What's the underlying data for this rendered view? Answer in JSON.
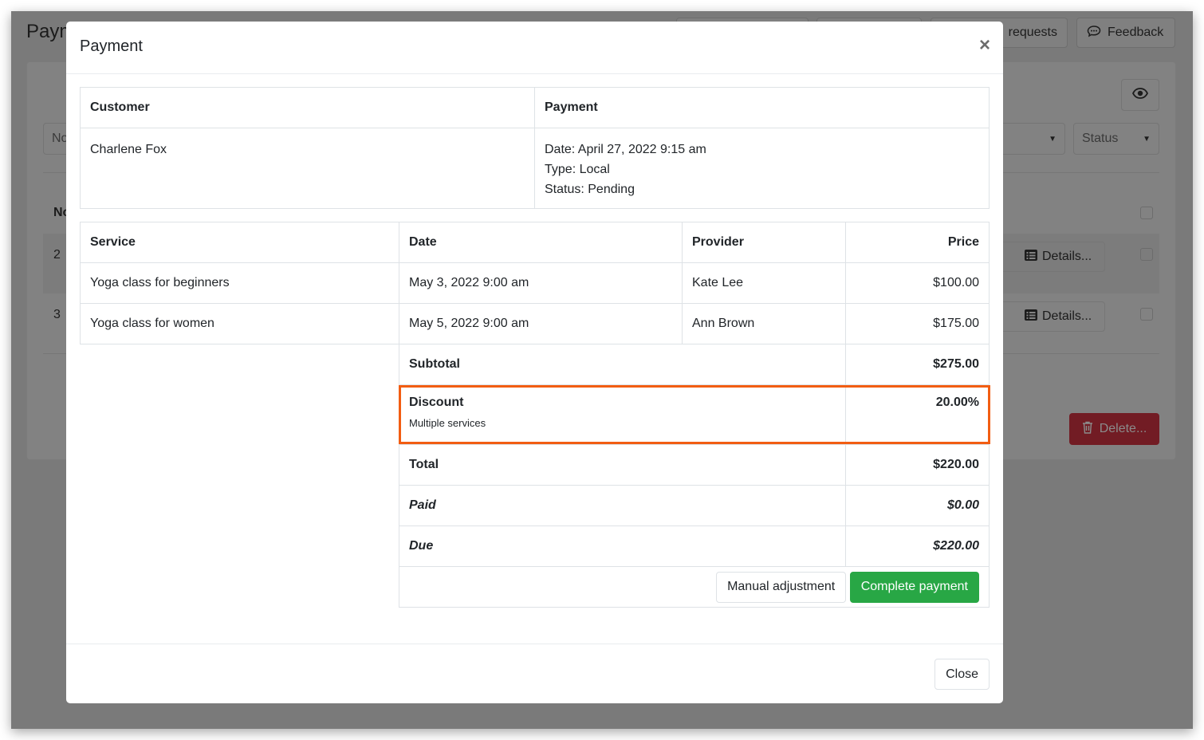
{
  "background": {
    "page_title": "Payments",
    "header_buttons": [
      {
        "label": "",
        "icon": ""
      },
      {
        "label": "",
        "icon": ""
      },
      {
        "label": "requests",
        "icon": ""
      },
      {
        "label": "Feedback",
        "icon": "chat-icon"
      }
    ],
    "filter_placeholder": "No",
    "status_select": "Status",
    "column_header": "No",
    "rows": [
      {
        "number": "2",
        "details_label": "Details..."
      },
      {
        "number": "3",
        "details_label": "Details..."
      }
    ],
    "delete_label": "Delete..."
  },
  "modal": {
    "title": "Payment",
    "close_symbol": "×",
    "info": {
      "customer_header": "Customer",
      "payment_header": "Payment",
      "customer_name": "Charlene Fox",
      "payment_date": "Date: April 27, 2022 9:15 am",
      "payment_type": "Type: Local",
      "payment_status": "Status: Pending"
    },
    "services": {
      "headers": [
        "Service",
        "Date",
        "Provider",
        "Price"
      ],
      "rows": [
        {
          "service": "Yoga class for beginners",
          "date": "May 3, 2022 9:00 am",
          "provider": "Kate Lee",
          "price": "$100.00"
        },
        {
          "service": "Yoga class for women",
          "date": "May 5, 2022 9:00 am",
          "provider": "Ann Brown",
          "price": "$175.00"
        }
      ]
    },
    "summary": {
      "subtotal_label": "Subtotal",
      "subtotal_value": "$275.00",
      "discount_label": "Discount",
      "discount_note": "Multiple services",
      "discount_value": "20.00%",
      "total_label": "Total",
      "total_value": "$220.00",
      "paid_label": "Paid",
      "paid_value": "$0.00",
      "due_label": "Due",
      "due_value": "$220.00"
    },
    "actions": {
      "manual_adjustment": "Manual adjustment",
      "complete_payment": "Complete payment"
    },
    "footer_close": "Close"
  },
  "colors": {
    "highlight": "#f25d12",
    "success": "#28a745",
    "danger": "#721c24"
  }
}
